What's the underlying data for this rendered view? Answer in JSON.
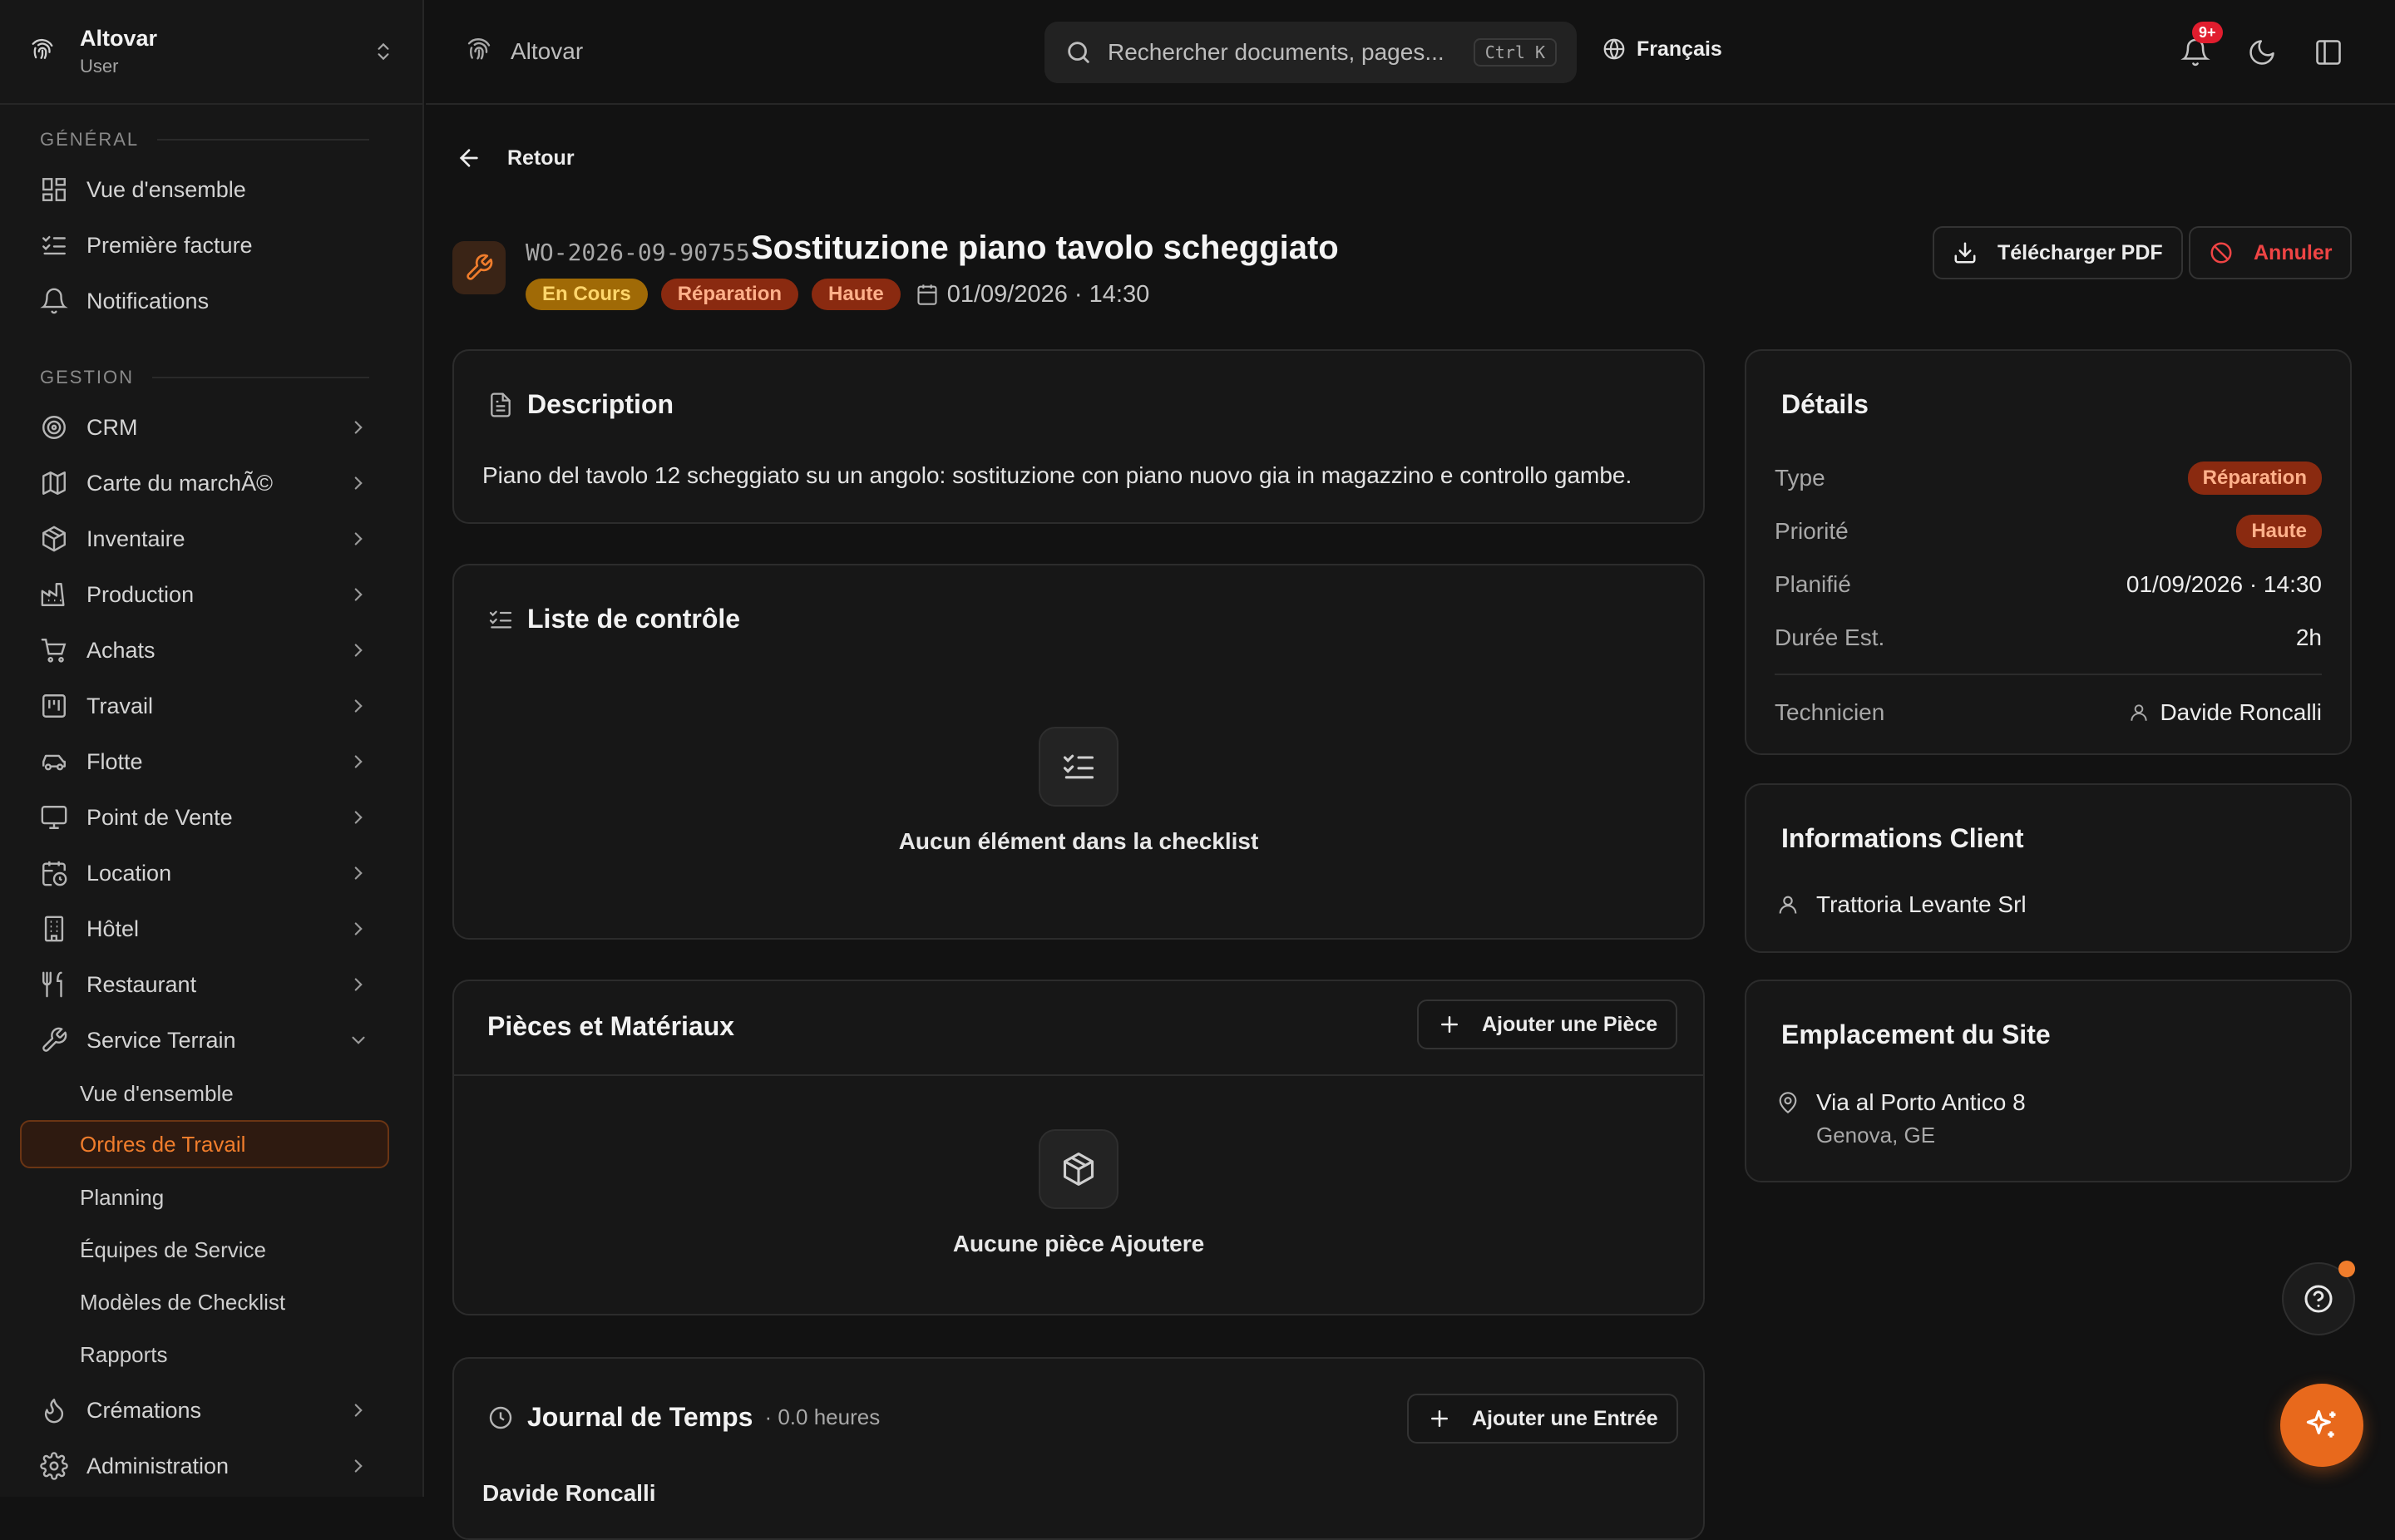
{
  "brand": {
    "name": "Altovar",
    "role": "User"
  },
  "sidebar": {
    "general_title": "GÉNÉRAL",
    "general": [
      {
        "label": "Vue d'ensemble",
        "icon": "dashboard-icon"
      },
      {
        "label": "Première facture",
        "icon": "checklist-icon"
      },
      {
        "label": "Notifications",
        "icon": "bell-icon"
      }
    ],
    "gestion_title": "GESTION",
    "gestion": [
      {
        "label": "CRM",
        "icon": "target-icon"
      },
      {
        "label": "Carte du marchÃ©",
        "icon": "map-icon"
      },
      {
        "label": "Inventaire",
        "icon": "package-icon"
      },
      {
        "label": "Production",
        "icon": "factory-icon"
      },
      {
        "label": "Achats",
        "icon": "cart-icon"
      },
      {
        "label": "Travail",
        "icon": "kanban-icon"
      },
      {
        "label": "Flotte",
        "icon": "car-icon"
      },
      {
        "label": "Point de Vente",
        "icon": "monitor-icon"
      },
      {
        "label": "Location",
        "icon": "calendar-clock-icon"
      },
      {
        "label": "Hôtel",
        "icon": "building-icon"
      },
      {
        "label": "Restaurant",
        "icon": "utensils-icon"
      },
      {
        "label": "Service Terrain",
        "icon": "wrench-icon"
      }
    ],
    "service_sub": [
      {
        "label": "Vue d'ensemble"
      },
      {
        "label": "Ordres de Travail",
        "active": true
      },
      {
        "label": "Planning"
      },
      {
        "label": "Équipes de Service"
      },
      {
        "label": "Modèles de Checklist"
      },
      {
        "label": "Rapports"
      }
    ],
    "bottom": [
      {
        "label": "Crémations",
        "icon": "flame-icon"
      },
      {
        "label": "Administration",
        "icon": "gear-icon"
      }
    ]
  },
  "topbar": {
    "breadcrumb": "Altovar",
    "search_placeholder": "Rechercher documents, pages...",
    "shortcut": "Ctrl K",
    "language": "Français",
    "notif_count": "9+"
  },
  "page": {
    "back_label": "Retour",
    "wo_code": "WO-2026-09-90755",
    "title": "Sostituzione piano tavolo scheggiato",
    "status": "En Cours",
    "type": "Réparation",
    "priority": "Haute",
    "datetime": "01/09/2026 · 14:30",
    "download_label": "Télécharger PDF",
    "cancel_label": "Annuler"
  },
  "description": {
    "title": "Description",
    "text": "Piano del tavolo 12 scheggiato su un angolo: sostituzione con piano nuovo gia in magazzino e controllo gambe."
  },
  "checklist": {
    "title": "Liste de contrôle",
    "empty": "Aucun élément dans la checklist"
  },
  "parts": {
    "title": "Pièces et Matériaux",
    "add_label": "Ajouter une Pièce",
    "empty": "Aucune pièce Ajoutere"
  },
  "timelog": {
    "title": "Journal de Temps",
    "hours": "· 0.0 heures",
    "add_label": "Ajouter une Entrée",
    "first_entry": "Davide Roncalli"
  },
  "details": {
    "title": "Détails",
    "type_label": "Type",
    "type_value": "Réparation",
    "priority_label": "Priorité",
    "priority_value": "Haute",
    "planned_label": "Planifié",
    "planned_value": "01/09/2026 · 14:30",
    "duration_label": "Durée Est.",
    "duration_value": "2h",
    "tech_label": "Technicien",
    "tech_value": "Davide Roncalli"
  },
  "client": {
    "title": "Informations Client",
    "name": "Trattoria Levante Srl"
  },
  "site": {
    "title": "Emplacement du Site",
    "address": "Via al Porto Antico 8",
    "city": "Genova, GE"
  },
  "colors": {
    "accent": "#f07d2c",
    "background": "#121212",
    "danger": "#ef4444"
  }
}
